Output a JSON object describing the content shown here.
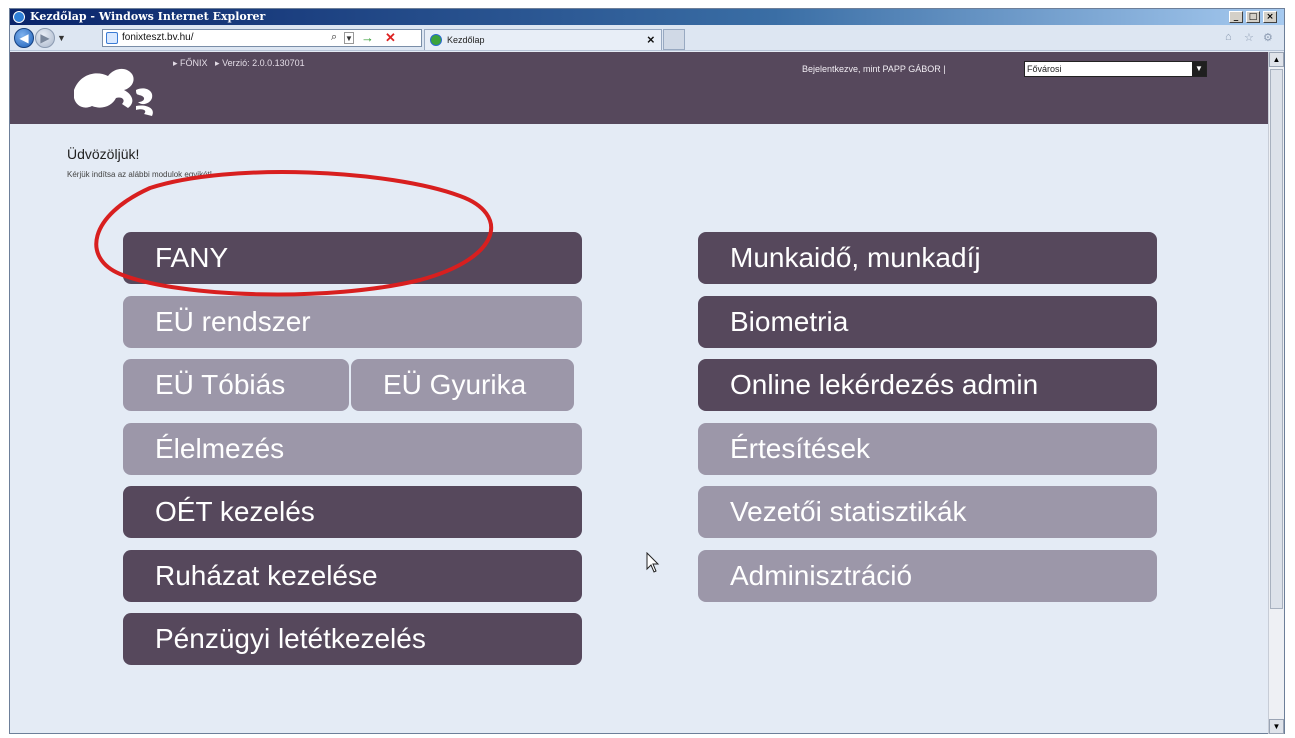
{
  "window": {
    "title": "Kezdőlap - Windows Internet Explorer",
    "controls": [
      "_",
      "□",
      "×"
    ]
  },
  "browser": {
    "address": "fonixteszt.bv.hu/",
    "tab_label": "Kezdőlap",
    "tab_close": "×"
  },
  "header": {
    "breadcrumbs": [
      "▸ FŐNIX",
      "▸ Verzió: 2.0.0.130701"
    ],
    "login_text": "Bejelentkezve, mint PAPP GÁBOR  |",
    "org_select": "Fővárosi"
  },
  "main": {
    "welcome": "Üdvözöljük!",
    "instruction": "Kérjük indítsa az alábbi modulok egyikét!",
    "modules_left": [
      {
        "label": "FANY",
        "state": "active"
      },
      {
        "label": "EÜ rendszer",
        "state": "disabled"
      },
      {
        "label": "EÜ Tóbiás",
        "state": "disabled"
      },
      {
        "label": "EÜ Gyurika",
        "state": "disabled"
      },
      {
        "label": "Élelmezés",
        "state": "disabled"
      },
      {
        "label": "OÉT kezelés",
        "state": "active"
      },
      {
        "label": "Ruházat kezelése",
        "state": "active"
      },
      {
        "label": "Pénzügyi letétkezelés",
        "state": "active"
      }
    ],
    "modules_right": [
      {
        "label": "Munkaidő, munkadíj",
        "state": "active"
      },
      {
        "label": "Biometria",
        "state": "active"
      },
      {
        "label": "Online lekérdezés admin",
        "state": "active"
      },
      {
        "label": "Értesítések",
        "state": "disabled"
      },
      {
        "label": "Vezetői statisztikák",
        "state": "disabled"
      },
      {
        "label": "Adminisztráció",
        "state": "disabled"
      }
    ]
  },
  "colors": {
    "active": "#56485c",
    "disabled": "#9c97a9",
    "annotation": "#d81f1f"
  },
  "icons": [
    "ie-logo-icon",
    "back-arrow-icon",
    "forward-arrow-icon",
    "search-icon",
    "go-arrow-icon",
    "stop-icon",
    "home-icon",
    "favorites-star-icon",
    "tools-gear-icon",
    "lion-logo",
    "mouse-cursor-icon"
  ]
}
